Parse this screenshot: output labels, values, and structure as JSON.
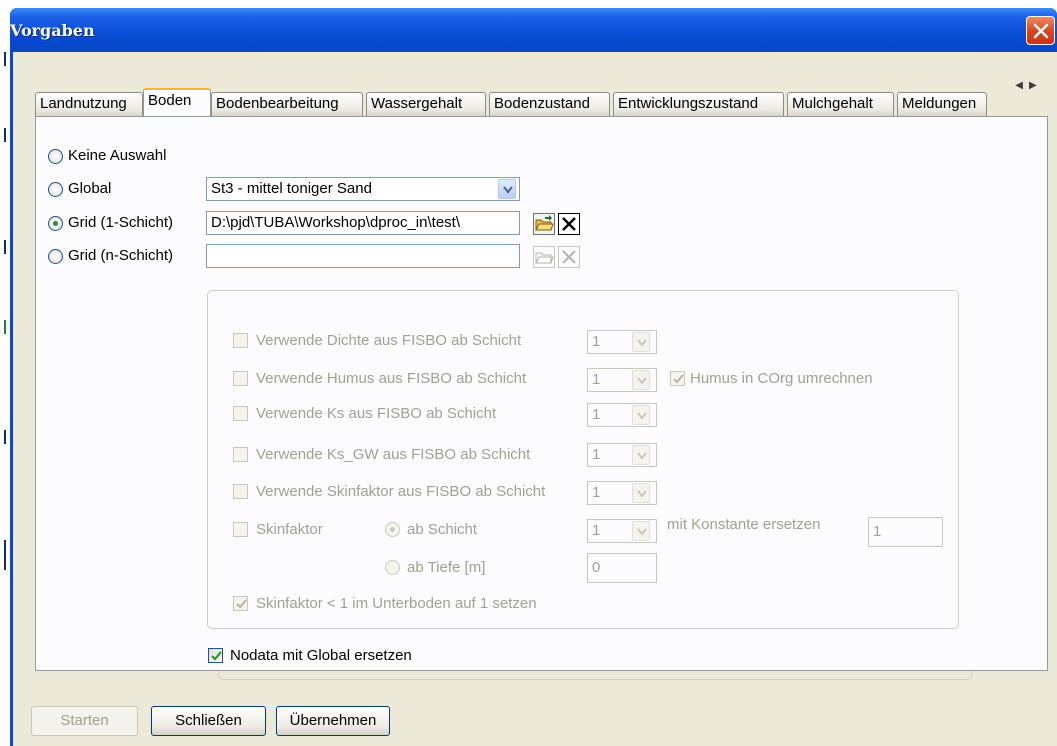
{
  "window": {
    "title": "Vorgaben"
  },
  "tabs": [
    {
      "label": "Landnutzung"
    },
    {
      "label": "Boden"
    },
    {
      "label": "Bodenbearbeitung"
    },
    {
      "label": "Wassergehalt"
    },
    {
      "label": "Bodenzustand"
    },
    {
      "label": "Entwicklungszustand"
    },
    {
      "label": "Mulchgehalt"
    },
    {
      "label": "Meldungen"
    }
  ],
  "source": {
    "none_label": "Keine Auswahl",
    "global_label": "Global",
    "global_value": "St3 - mittel toniger Sand",
    "grid1_label": "Grid (1-Schicht)",
    "grid1_path": "D:\\pjd\\TUBA\\Workshop\\dproc_in\\test\\",
    "gridn_label": "Grid (n-Schicht)",
    "gridn_path": "",
    "selected": "Grid (1-Schicht)"
  },
  "fisbo": {
    "rows": [
      {
        "label": "Verwende Dichte aus FISBO ab Schicht",
        "value": "1",
        "checked": false
      },
      {
        "label": "Verwende Humus aus FISBO ab Schicht",
        "value": "1",
        "checked": false
      },
      {
        "label": "Verwende Ks aus FISBO ab Schicht",
        "value": "1",
        "checked": false
      },
      {
        "label": "Verwende Ks_GW aus FISBO ab Schicht",
        "value": "1",
        "checked": false
      },
      {
        "label": "Verwende Skinfaktor aus FISBO ab Schicht",
        "value": "1",
        "checked": false
      }
    ],
    "humus_corg_label": "Humus in COrg umrechnen",
    "humus_corg_checked": true,
    "skin_label": "Skinfaktor",
    "ab_schicht_label": "ab Schicht",
    "ab_schicht_value": "1",
    "ab_tiefe_label": "ab Tiefe [m]",
    "ab_tiefe_value": "0",
    "const_label": "mit Konstante ersetzen",
    "const_value": "1",
    "skin_unterboden_label": "Skinfaktor < 1 im Unterboden auf 1 setzen",
    "skin_unterboden_checked": true
  },
  "nodata": {
    "label": "Nodata mit Global ersetzen",
    "checked": true
  },
  "buttons": {
    "start": "Starten",
    "close": "Schließen",
    "apply": "Übernehmen"
  }
}
